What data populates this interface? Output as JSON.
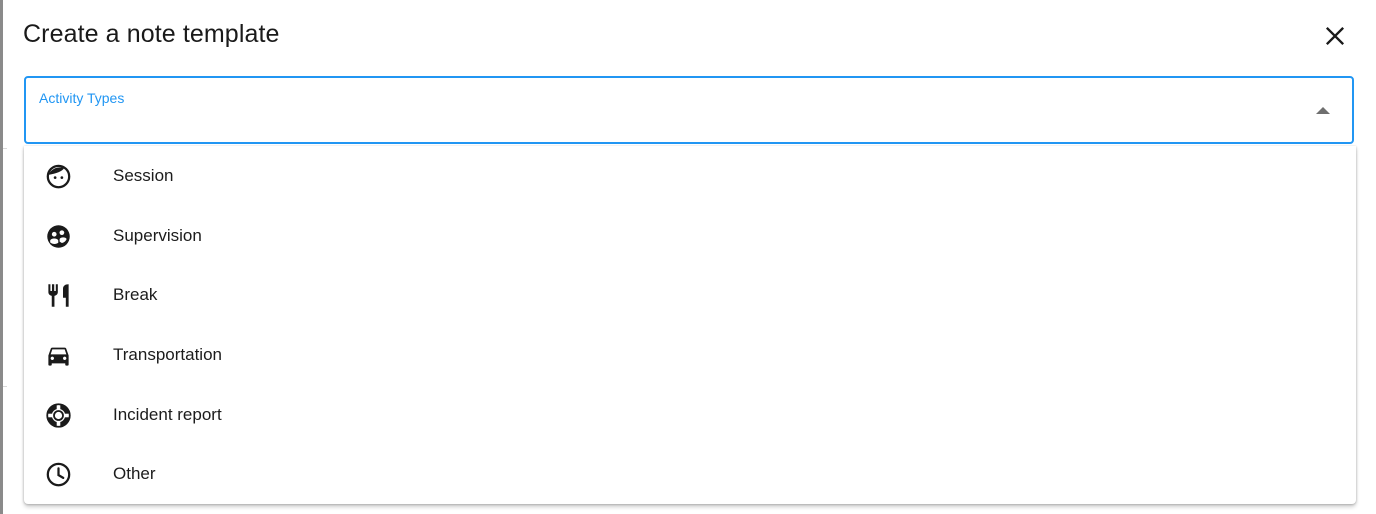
{
  "dialog": {
    "title": "Create a note template"
  },
  "select": {
    "label": "Activity Types",
    "accent_color": "#2196f3",
    "expanded": true
  },
  "menu": {
    "items": [
      {
        "label": "Session",
        "icon": "face-icon"
      },
      {
        "label": "Supervision",
        "icon": "supervision-icon"
      },
      {
        "label": "Break",
        "icon": "restaurant-icon"
      },
      {
        "label": "Transportation",
        "icon": "car-icon"
      },
      {
        "label": "Incident report",
        "icon": "life-buoy-icon"
      },
      {
        "label": "Other",
        "icon": "clock-icon"
      }
    ]
  }
}
